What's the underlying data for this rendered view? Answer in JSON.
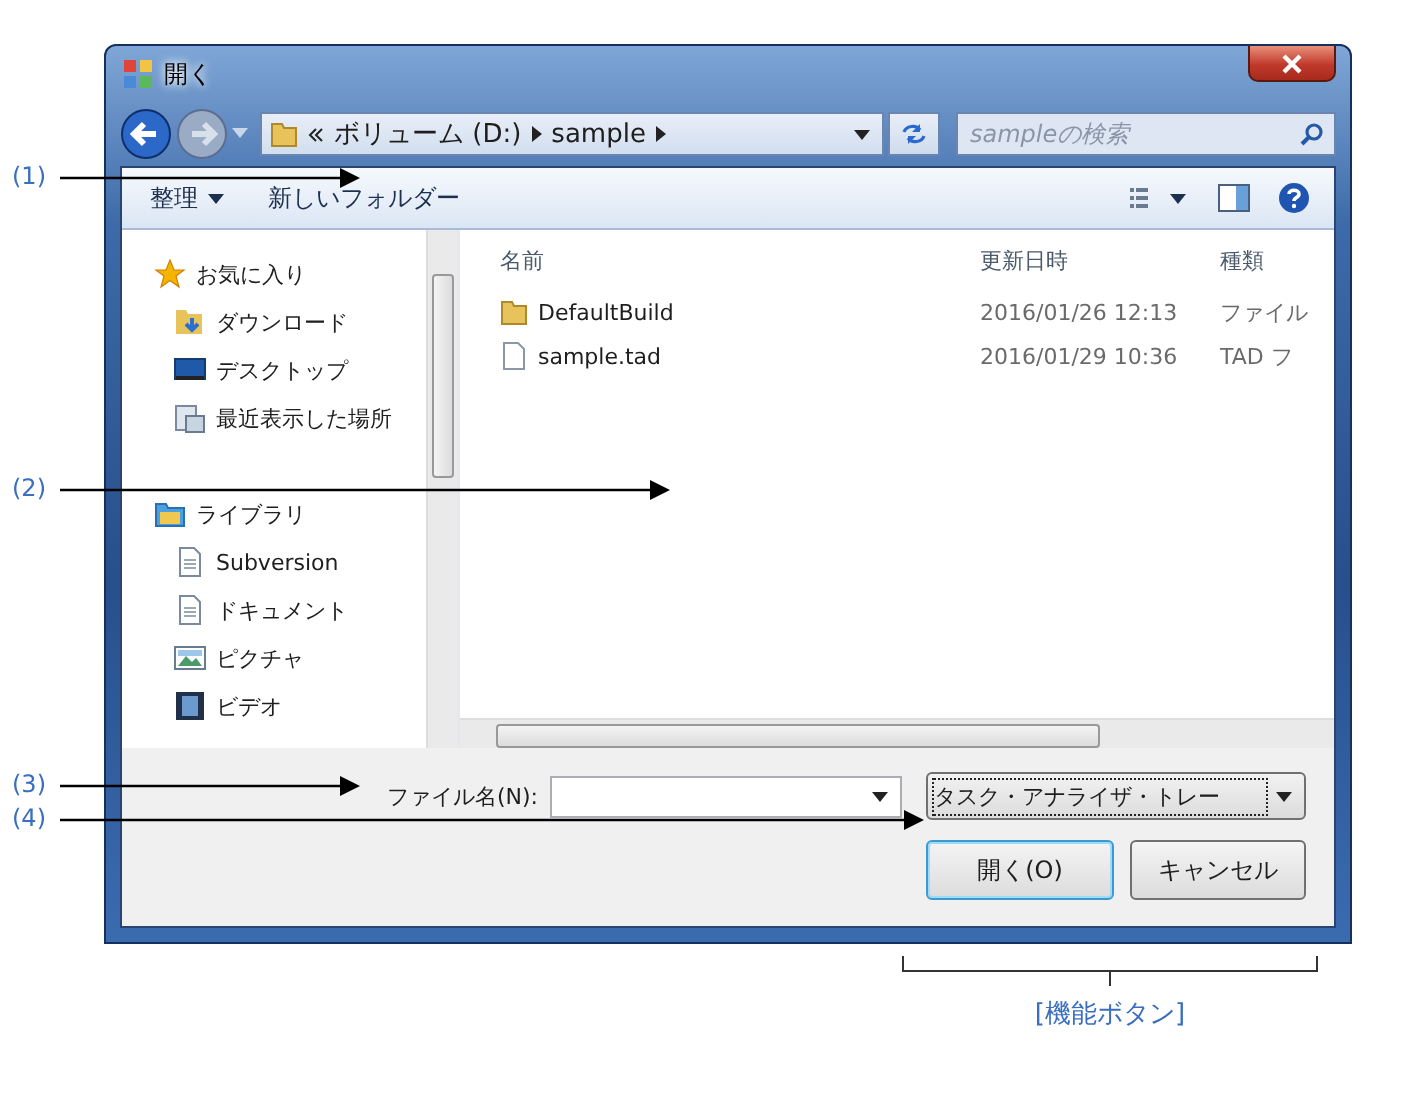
{
  "window": {
    "title": "開く"
  },
  "address": {
    "crumbs": [
      "ボリューム (D:)",
      "sample"
    ]
  },
  "search": {
    "placeholder": "sampleの検索"
  },
  "toolbar": [
    {
      "label": "整理",
      "dropdown": true
    },
    {
      "label": "新しいフォルダー",
      "dropdown": false
    }
  ],
  "sidebar": {
    "groups": [
      {
        "label": "お気に入り",
        "kind": "favorites",
        "children": [
          {
            "label": "ダウンロード",
            "kind": "download"
          },
          {
            "label": "デスクトップ",
            "kind": "desktop"
          },
          {
            "label": "最近表示した場所",
            "kind": "recent"
          }
        ]
      },
      {
        "label": "ライブラリ",
        "kind": "library",
        "children": [
          {
            "label": "Subversion",
            "kind": "doc"
          },
          {
            "label": "ドキュメント",
            "kind": "doc"
          },
          {
            "label": "ピクチャ",
            "kind": "picture"
          },
          {
            "label": "ビデオ",
            "kind": "video"
          }
        ]
      }
    ]
  },
  "file_list": {
    "columns": [
      "名前",
      "更新日時",
      "種類"
    ],
    "rows": [
      {
        "kind": "folder",
        "name": "DefaultBuild",
        "modified": "2016/01/26 12:13",
        "type": "ファイル"
      },
      {
        "kind": "file",
        "name": "sample.tad",
        "modified": "2016/01/29 10:36",
        "type": "TAD フ"
      }
    ]
  },
  "filename": {
    "label": "ファイル名(N):"
  },
  "filter": {
    "value": "タスク・アナライザ・トレー"
  },
  "buttons": [
    {
      "label": "開く(O)",
      "default": true
    },
    {
      "label": "キャンセル",
      "default": false
    }
  ],
  "callouts": [
    "(1)",
    "(2)",
    "(3)",
    "(4)"
  ],
  "bracket_label": "[機能ボタン]"
}
